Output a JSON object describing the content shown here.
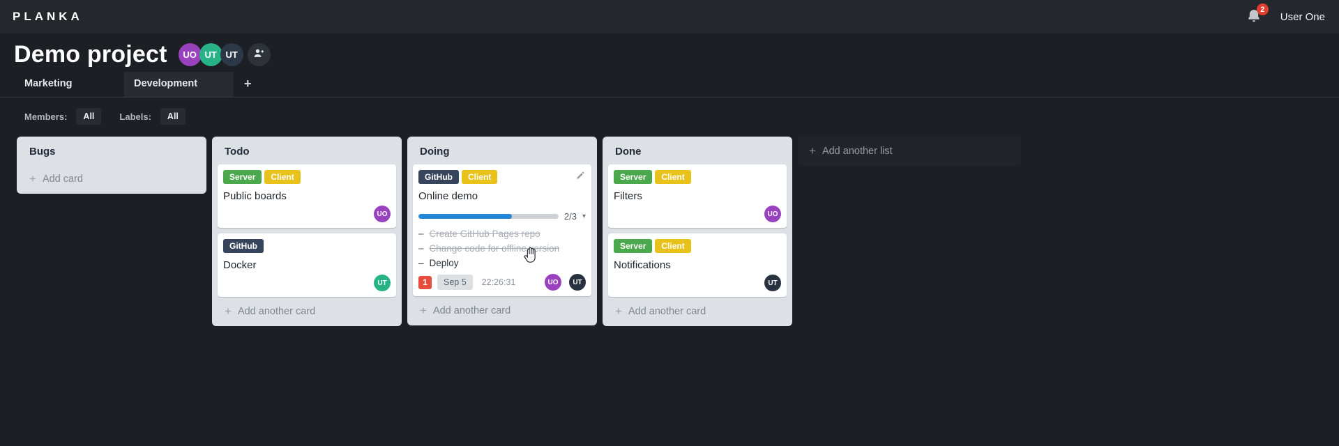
{
  "topbar": {
    "logo": "PLANKA",
    "notification_count": "2",
    "user_name": "User One"
  },
  "project": {
    "title": "Demo project",
    "members": [
      {
        "initials": "UO",
        "color": "#9a42bd"
      },
      {
        "initials": "UT",
        "color": "#27b386"
      },
      {
        "initials": "UT",
        "color": "#2c3847"
      }
    ]
  },
  "tabs": {
    "items": [
      {
        "label": "Marketing"
      },
      {
        "label": "Development"
      }
    ],
    "add_label": "+"
  },
  "filters": {
    "members_label": "Members:",
    "members_value": "All",
    "labels_label": "Labels:",
    "labels_value": "All"
  },
  "icons": {
    "plus": "+",
    "chevron_down": "▾",
    "task_marker": "–",
    "bell": "bell-icon",
    "edit": "pencil-icon",
    "add_member": "person-add-icon",
    "cursor": "hand-cursor"
  },
  "board": {
    "add_list_label": "Add another list",
    "lists": [
      {
        "title": "Bugs",
        "add_label": "Add card",
        "cards": []
      },
      {
        "title": "Todo",
        "add_label": "Add another card",
        "cards": [
          {
            "title": "Public boards",
            "labels": [
              {
                "text": "Server",
                "color": "#4ba84c"
              },
              {
                "text": "Client",
                "color": "#e8c21a"
              }
            ],
            "members": [
              {
                "initials": "UO",
                "color": "#9a42bd"
              }
            ]
          },
          {
            "title": "Docker",
            "labels": [
              {
                "text": "GitHub",
                "color": "#37455c"
              }
            ],
            "members": [
              {
                "initials": "UT",
                "color": "#27b386"
              }
            ]
          }
        ]
      },
      {
        "title": "Doing",
        "add_label": "Add another card",
        "cards": [
          {
            "title": "Online demo",
            "labels": [
              {
                "text": "GitHub",
                "color": "#37455c"
              },
              {
                "text": "Client",
                "color": "#e8c21a"
              }
            ],
            "progress": {
              "display": "2/3",
              "percent": 66.7
            },
            "tasks": [
              {
                "text": "Create GitHub Pages repo",
                "done": true
              },
              {
                "text": "Change code for offline version",
                "done": true
              },
              {
                "text": "Deploy",
                "done": false
              }
            ],
            "notification_count": "1",
            "due_date": "Sep 5",
            "timer": "22:26:31",
            "members": [
              {
                "initials": "UO",
                "color": "#9a42bd"
              },
              {
                "initials": "UT",
                "color": "#28313f"
              }
            ]
          }
        ]
      },
      {
        "title": "Done",
        "add_label": "Add another card",
        "cards": [
          {
            "title": "Filters",
            "labels": [
              {
                "text": "Server",
                "color": "#4ba84c"
              },
              {
                "text": "Client",
                "color": "#e8c21a"
              }
            ],
            "members": [
              {
                "initials": "UO",
                "color": "#9a42bd"
              }
            ]
          },
          {
            "title": "Notifications",
            "labels": [
              {
                "text": "Server",
                "color": "#4ba84c"
              },
              {
                "text": "Client",
                "color": "#e8c21a"
              }
            ],
            "members": [
              {
                "initials": "UT",
                "color": "#28313f"
              }
            ]
          }
        ]
      }
    ]
  }
}
